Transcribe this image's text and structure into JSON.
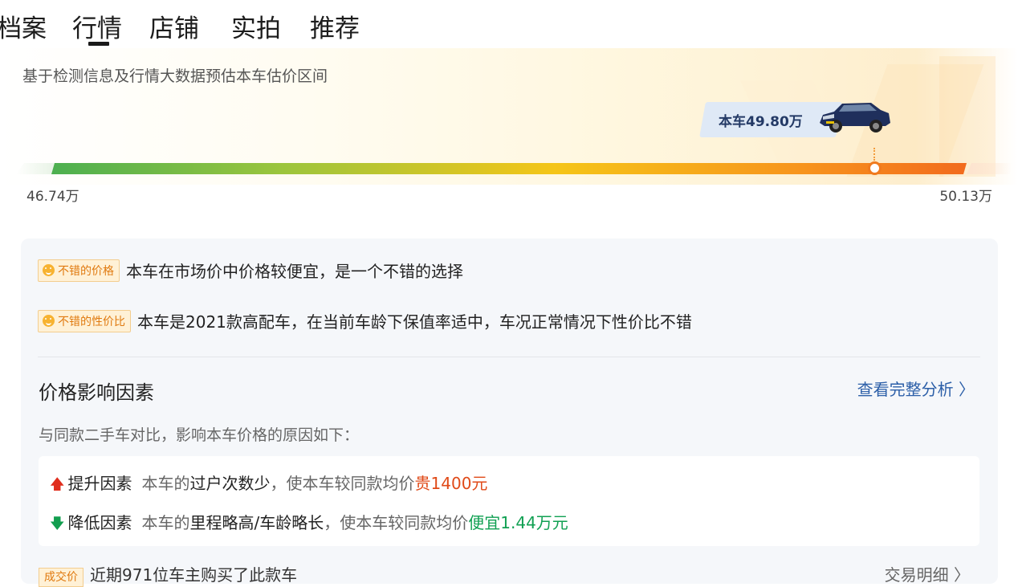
{
  "tabs": [
    {
      "label": "档案",
      "active": false
    },
    {
      "label": "行情",
      "active": true
    },
    {
      "label": "店铺",
      "active": false
    },
    {
      "label": "实拍",
      "active": false
    },
    {
      "label": "推荐",
      "active": false
    }
  ],
  "price_range": {
    "subtitle": "基于检测信息及行情大数据预估本车估价区间",
    "current_label": "本车49.80万",
    "min_label": "46.74万",
    "max_label": "50.13万",
    "min_value": 46.74,
    "max_value": 50.13,
    "current_value": 49.8,
    "car_icon": "car-photo-icon",
    "bar_colors": [
      "#4caf50",
      "#9bc53d",
      "#f5c518",
      "#f7941d",
      "#f26b1d"
    ]
  },
  "tags": [
    {
      "icon": "smile-icon",
      "tag": "不错的价格",
      "desc": "本车在市场价中价格较便宜，是一个不错的选择"
    },
    {
      "icon": "smile-icon",
      "tag": "不错的性价比",
      "desc": "本车是2021款高配车，在当前车龄下保值率适中，车况正常情况下性价比不错"
    }
  ],
  "factors": {
    "title": "价格影响因素",
    "link": "查看完整分析 〉",
    "subtitle": "与同款二手车对比，影响本车价格的原因如下：",
    "up": {
      "icon": "arrow-up-icon",
      "label": "提升因素",
      "pre": "本车的",
      "bold": "过户次数少",
      "mid": "，使本车较同款均价",
      "highlight": "贵1400元"
    },
    "down": {
      "icon": "arrow-down-icon",
      "label": "降低因素",
      "pre": "本车的",
      "bold": "里程略高/车龄略长",
      "mid": "，使本车较同款均价",
      "highlight": "便宜1.44万元"
    }
  },
  "next_row": {
    "tag": "成交价",
    "text": "近期971位车主购买了此款车",
    "link": "交易明细 〉"
  },
  "colors": {
    "accent_link": "#2c5fa8",
    "up_red": "#e04a18",
    "down_green": "#10a052",
    "tag_orange": "#e07a10"
  }
}
